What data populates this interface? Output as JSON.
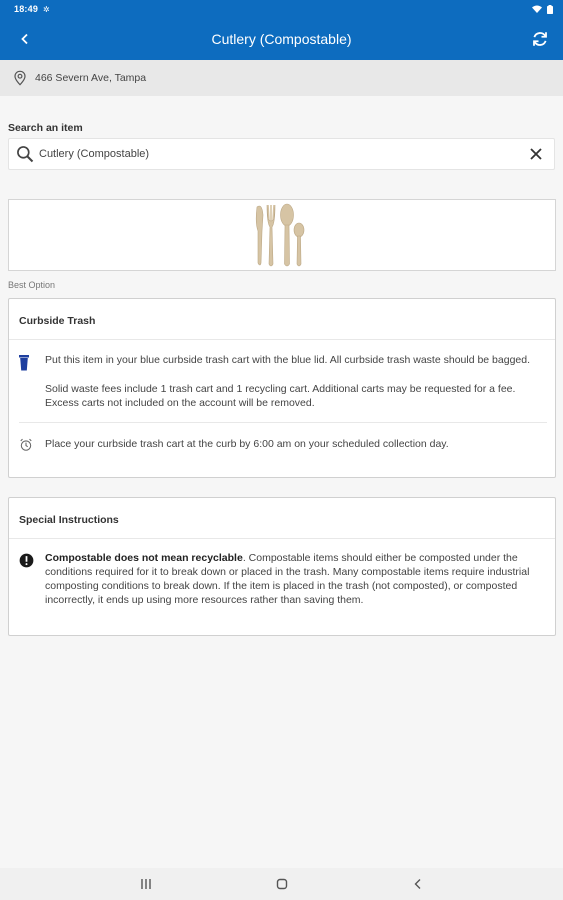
{
  "status_bar": {
    "time": "18:49",
    "notification_icon": "gear-icon"
  },
  "header": {
    "title": "Cutlery (Compostable)",
    "back_icon": "chevron-left-icon",
    "refresh_icon": "refresh-icon",
    "color": "#0d6cbf"
  },
  "location": {
    "address": "466 Severn Ave, Tampa"
  },
  "search": {
    "label": "Search an item",
    "value": "Cutlery (Compostable)"
  },
  "best_option_label": "Best Option",
  "disposal": {
    "title": "Curbside Trash",
    "instruction": "Put this item in your blue curbside trash cart with the blue lid. All curbside trash waste should be bagged.",
    "fees": "Solid waste fees include 1 trash cart and 1 recycling cart. Additional carts may be requested for a fee. Excess carts not included on the account will be removed.",
    "schedule": "Place your curbside trash cart at the curb by 6:00 am on your scheduled collection day.",
    "cart_color": "#1f3f9f"
  },
  "special": {
    "title": "Special Instructions",
    "bold": "Compostable does not mean recyclable",
    "text": ". Compostable items should either be composted under the conditions required for it to break down or placed in the trash. Many compostable items require industrial composting conditions to break down. If the item is placed in the trash (not composted), or composted incorrectly, it ends up using more resources rather than saving them."
  }
}
